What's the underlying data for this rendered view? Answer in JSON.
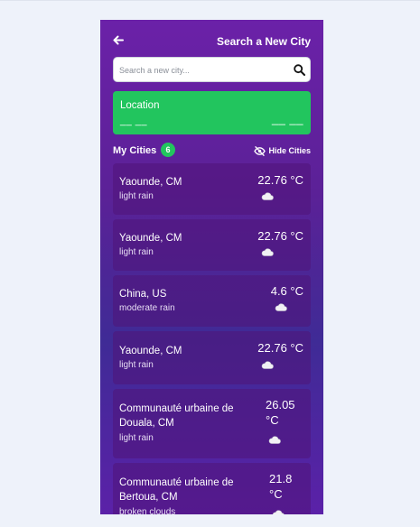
{
  "header": {
    "title": "Search a New City"
  },
  "search": {
    "placeholder": "Search a new city..."
  },
  "location": {
    "title": "Location",
    "left_value": "__ __",
    "right_value": "__ __"
  },
  "cities": {
    "title": "My Cities",
    "count": "6",
    "hide_label": "Hide Cities",
    "items": [
      {
        "name": "Yaounde, CM",
        "desc": "light rain",
        "temp": "22.76 °C",
        "icon": "cloud-icon"
      },
      {
        "name": "Yaounde, CM",
        "desc": "light rain",
        "temp": "22.76 °C",
        "icon": "cloud-icon"
      },
      {
        "name": "China, US",
        "desc": "moderate rain",
        "temp": "4.6 °C",
        "icon": "cloud-icon"
      },
      {
        "name": "Yaounde, CM",
        "desc": "light rain",
        "temp": "22.76 °C",
        "icon": "cloud-icon"
      },
      {
        "name": "Communauté urbaine de Douala, CM",
        "desc": "light rain",
        "temp": "26.05 °C",
        "icon": "cloud-icon"
      },
      {
        "name": "Communauté urbaine de Bertoua, CM",
        "desc": "broken clouds",
        "temp": "21.8 °C",
        "icon": "cloud-icon"
      }
    ]
  },
  "colors": {
    "accent": "#22c55e",
    "panel": "#6b21a8"
  }
}
